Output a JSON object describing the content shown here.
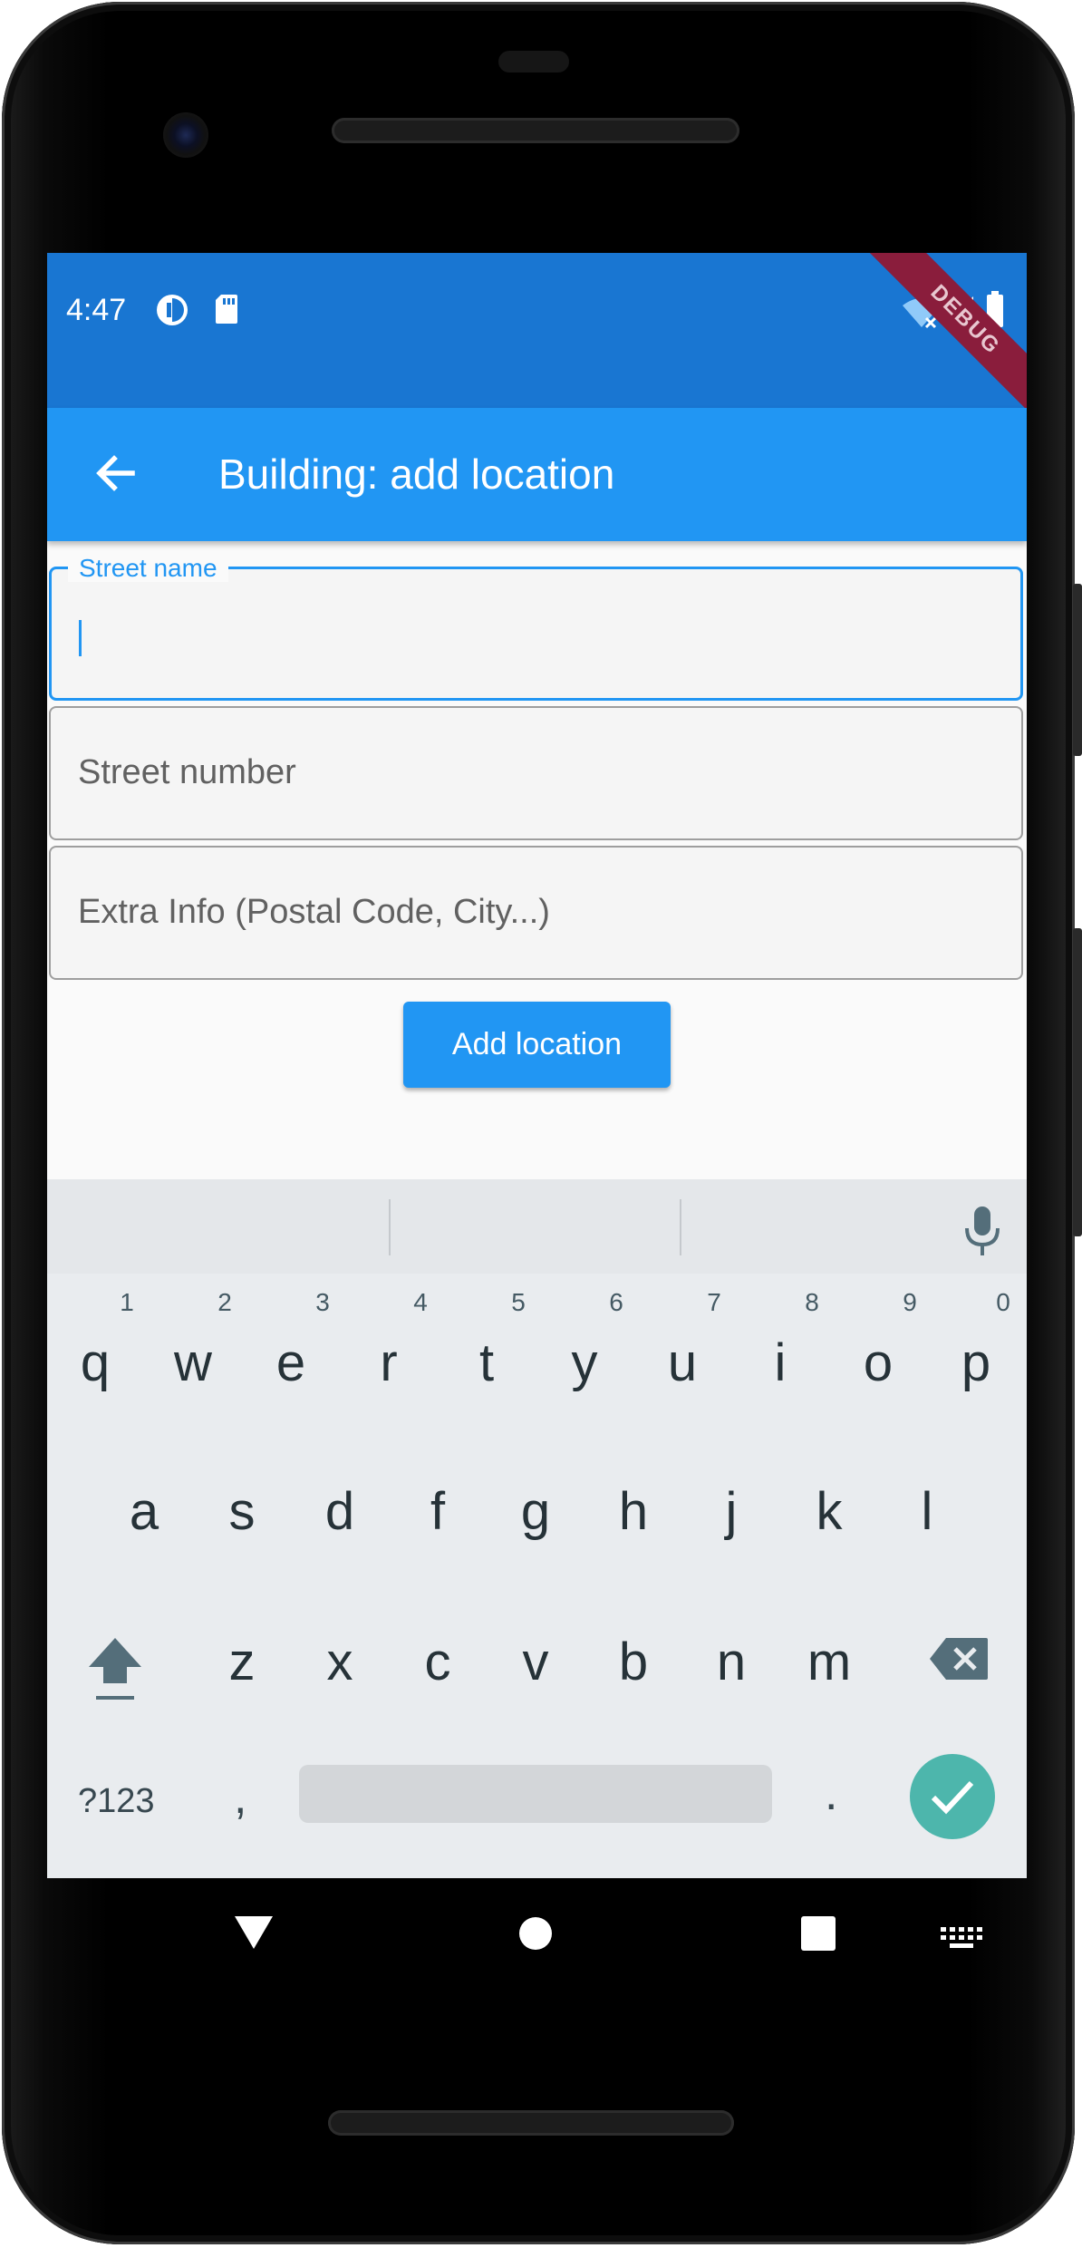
{
  "status_bar": {
    "time": "4:47",
    "debug_banner": "DEBUG"
  },
  "app_bar": {
    "title": "Building: add location"
  },
  "form": {
    "street_name": {
      "label": "Street name",
      "value": ""
    },
    "street_number": {
      "placeholder": "Street number"
    },
    "extra_info": {
      "placeholder": "Extra Info (Postal Code, City...)"
    },
    "submit_label": "Add location"
  },
  "keyboard": {
    "row1": [
      "q",
      "w",
      "e",
      "r",
      "t",
      "y",
      "u",
      "i",
      "o",
      "p"
    ],
    "row1_hints": [
      "1",
      "2",
      "3",
      "4",
      "5",
      "6",
      "7",
      "8",
      "9",
      "0"
    ],
    "row2": [
      "a",
      "s",
      "d",
      "f",
      "g",
      "h",
      "j",
      "k",
      "l"
    ],
    "row3": [
      "z",
      "x",
      "c",
      "v",
      "b",
      "n",
      "m"
    ],
    "symbols_label": "?123",
    "comma": ",",
    "period": "."
  },
  "colors": {
    "status_bar": "#1976d2",
    "app_bar": "#2196f3",
    "accent": "#2196f3",
    "enter_key": "#4db6ac",
    "debug_banner": "#8a1d3c"
  }
}
